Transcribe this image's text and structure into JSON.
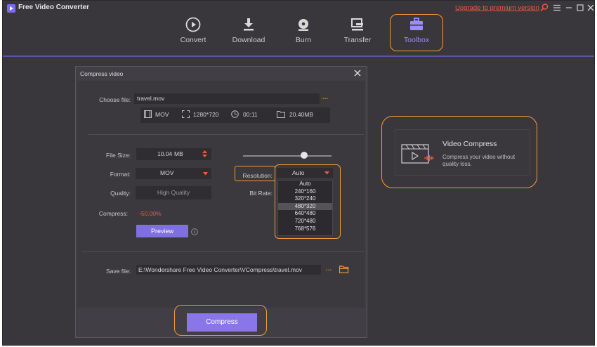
{
  "app": {
    "title": "Free Video Converter",
    "upgrade_link": "Upgrade to premium version"
  },
  "nav": {
    "items": [
      {
        "label": "Convert",
        "icon": "convert-icon"
      },
      {
        "label": "Download",
        "icon": "download-icon"
      },
      {
        "label": "Burn",
        "icon": "burn-icon"
      },
      {
        "label": "Transfer",
        "icon": "transfer-icon"
      },
      {
        "label": "Toolbox",
        "icon": "toolbox-icon",
        "active": true
      }
    ]
  },
  "dialog": {
    "title": "Compress video",
    "choose_file_label": "Choose file:",
    "file_name": "travel.mov",
    "more_glyph": "···",
    "file_info": {
      "format": "MOV",
      "resolution": "1280*720",
      "duration": "00:11",
      "size": "20.40MB"
    },
    "file_size_label": "File Size:",
    "file_size_value": "10.04",
    "file_size_unit": "MB",
    "format_label": "Format:",
    "format_value": "MOV",
    "quality_label": "Quality:",
    "quality_value": "High Quality",
    "compress_label": "Compress:",
    "compress_value": "-50.00%",
    "preview_button": "Preview",
    "resolution_label": "Resolution:",
    "resolution_value": "Auto",
    "resolution_options": [
      "Auto",
      "240*160",
      "320*240",
      "480*320",
      "640*480",
      "720*480",
      "768*576"
    ],
    "resolution_highlighted": "480*320",
    "bitrate_label": "Bit Rate:",
    "save_file_label": "Save file:",
    "save_path": "E:\\Wondershare Free Video Converter\\VCompress\\travel.mov",
    "compress_button": "Compress"
  },
  "card": {
    "title": "Video Compress",
    "description": "Compress your video without quality loss."
  },
  "colors": {
    "accent": "#8a76e8",
    "highlight": "#f39a3a",
    "compress_text": "#f05a3a",
    "background": "#39373c"
  }
}
